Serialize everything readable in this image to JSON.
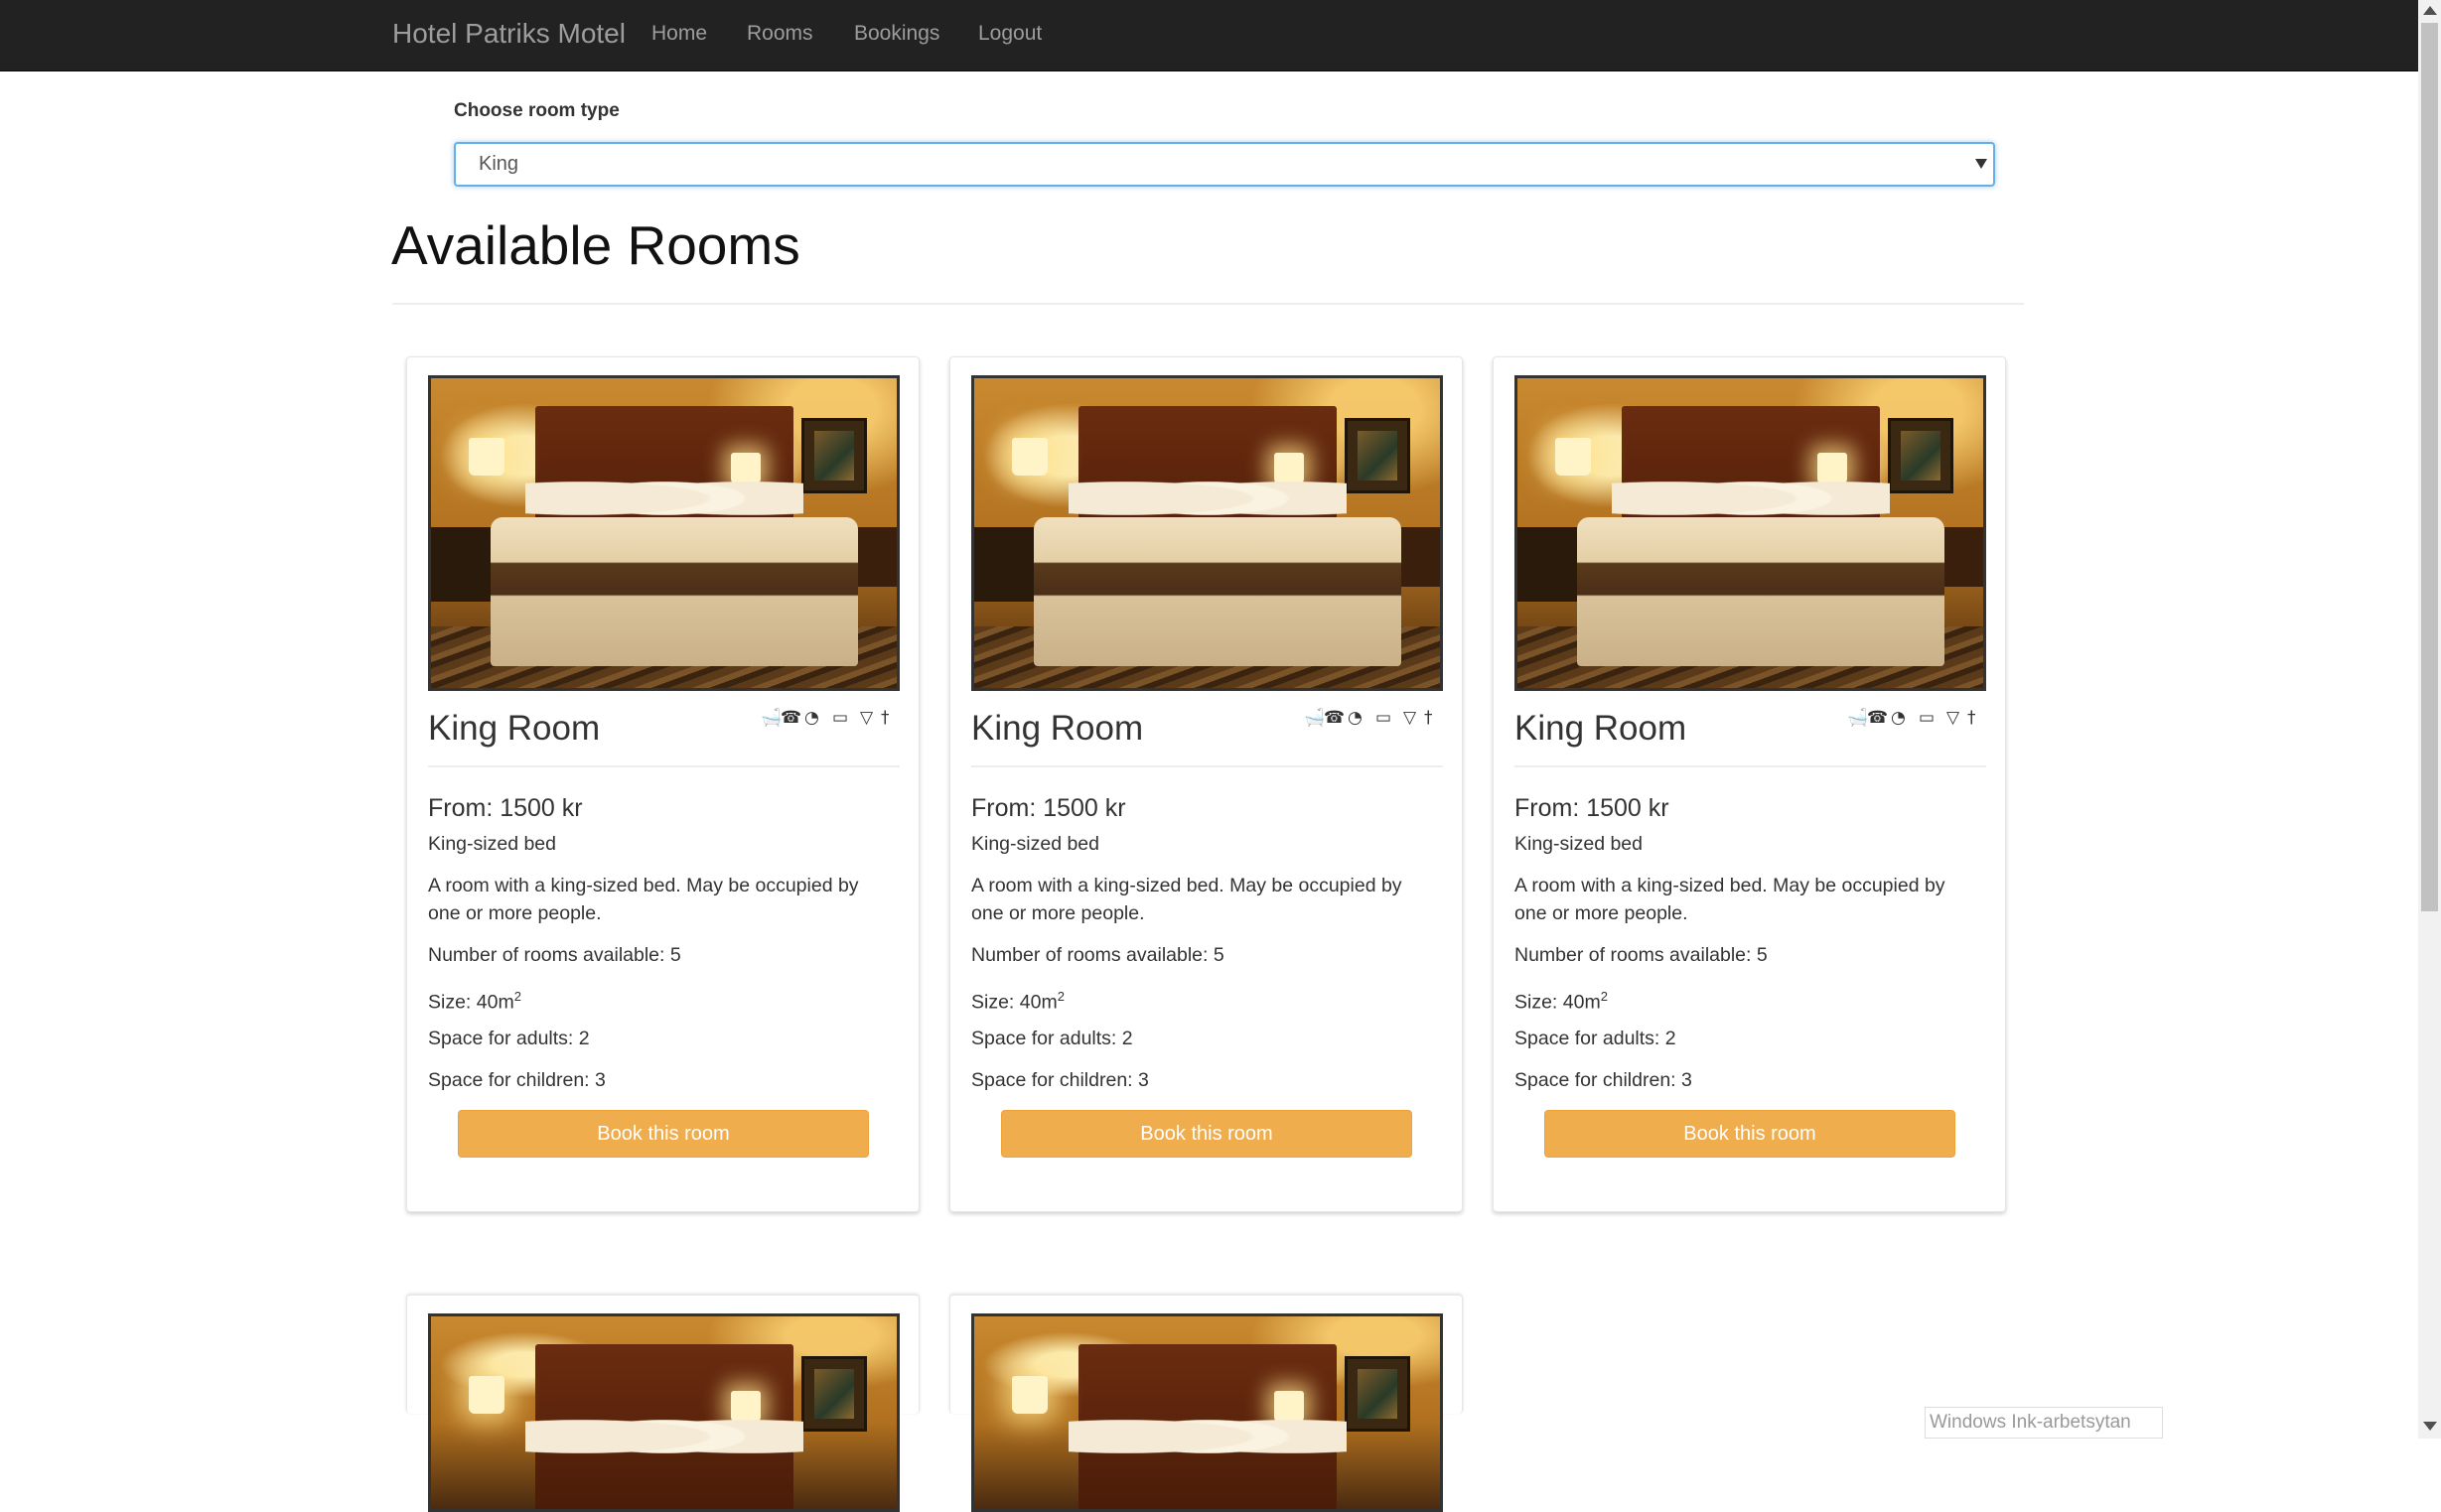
{
  "navbar": {
    "brand": "Hotel Patriks Motel",
    "links": [
      "Home",
      "Rooms",
      "Bookings",
      "Logout"
    ]
  },
  "filter": {
    "label": "Choose room type",
    "selected": "King"
  },
  "page": {
    "title": "Available Rooms"
  },
  "amenity_icons": [
    "bathtub-icon",
    "phone-icon",
    "wifi-icon",
    "tv-icon",
    "cocktail-icon",
    "restaurant-icon"
  ],
  "rooms": [
    {
      "name": "King Room",
      "price": "From: 1500 kr",
      "bed": "King-sized bed",
      "description": "A room with a king-sized bed. May be occupied by one or more people.",
      "available": "Number of rooms available: 5",
      "size_label": "Size: 40m",
      "size_sup": "2",
      "adults": "Space for adults: 2",
      "children": "Space for children: 3",
      "button": "Book this room"
    },
    {
      "name": "King Room",
      "price": "From: 1500 kr",
      "bed": "King-sized bed",
      "description": "A room with a king-sized bed. May be occupied by one or more people.",
      "available": "Number of rooms available: 5",
      "size_label": "Size: 40m",
      "size_sup": "2",
      "adults": "Space for adults: 2",
      "children": "Space for children: 3",
      "button": "Book this room"
    },
    {
      "name": "King Room",
      "price": "From: 1500 kr",
      "bed": "King-sized bed",
      "description": "A room with a king-sized bed. May be occupied by one or more people.",
      "available": "Number of rooms available: 5",
      "size_label": "Size: 40m",
      "size_sup": "2",
      "adults": "Space for adults: 2",
      "children": "Space for children: 3",
      "button": "Book this room"
    }
  ],
  "overlay": {
    "ink_tooltip": "Windows Ink-arbetsytan"
  },
  "colors": {
    "navbar_bg": "#222222",
    "nav_text": "#9d9d9d",
    "button_warning": "#f0ad4e",
    "focus_border": "#66afe9"
  }
}
